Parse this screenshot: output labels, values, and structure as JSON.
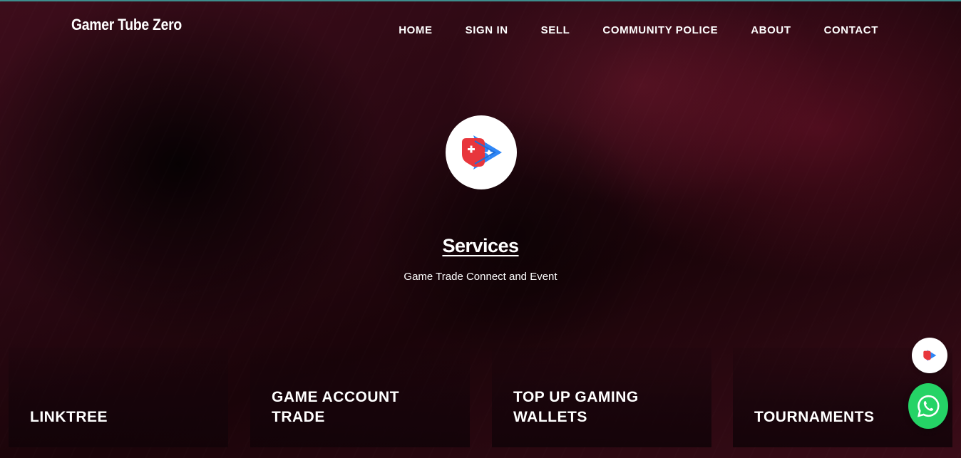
{
  "brand": {
    "name": "Gamer Tube Zero"
  },
  "nav": {
    "items": [
      {
        "label": "HOME"
      },
      {
        "label": "SIGN IN"
      },
      {
        "label": "SELL"
      },
      {
        "label": "COMMUNITY POLICE"
      },
      {
        "label": "ABOUT"
      },
      {
        "label": "CONTACT"
      }
    ]
  },
  "hero": {
    "title": "Services",
    "subtitle": "Game Trade Connect and Event"
  },
  "cards": [
    {
      "title": "LINKTREE"
    },
    {
      "title": "GAME ACCOUNT TRADE"
    },
    {
      "title": "TOP UP GAMING WALLETS"
    },
    {
      "title": "TOURNAMENTS"
    }
  ],
  "colors": {
    "accent_blue": "#2f86f6",
    "accent_red": "#e8363c",
    "whatsapp_green": "#25d366",
    "top_line": "#3e8e8e"
  },
  "icons": {
    "logo": "gamepad-arrow-icon",
    "whatsapp": "whatsapp-icon"
  }
}
